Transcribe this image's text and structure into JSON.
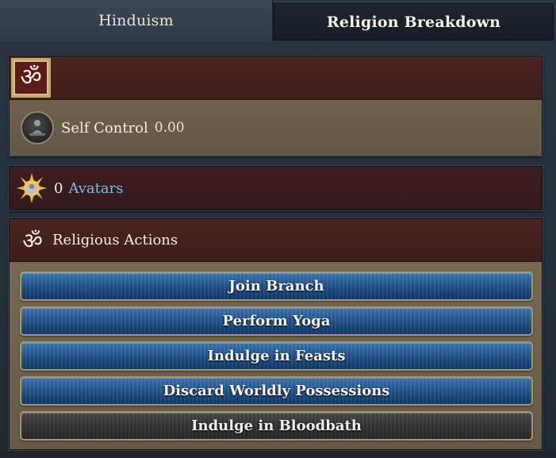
{
  "tabs": {
    "religion_tab": "Hinduism",
    "breakdown_tab": "Religion Breakdown"
  },
  "religion_panel": {
    "icon": "om-icon",
    "stat_icon": "self-control-icon",
    "stat_label": "Self Control",
    "stat_value": "0.00"
  },
  "avatars_panel": {
    "icon": "sun-avatar-icon",
    "count": "0",
    "link_label": "Avatars",
    "link_color": "#7fb8e8"
  },
  "actions_panel": {
    "icon": "om-icon",
    "title": "Religious Actions",
    "buttons": [
      {
        "label": "Join Branch",
        "state": "enabled"
      },
      {
        "label": "Perform Yoga",
        "state": "enabled"
      },
      {
        "label": "Indulge in Feasts",
        "state": "enabled"
      },
      {
        "label": "Discard Worldly Possessions",
        "state": "enabled"
      },
      {
        "label": "Indulge in Bloodbath",
        "state": "disabled"
      }
    ]
  },
  "colors": {
    "button_blue": "#285e98",
    "button_disabled": "#363636",
    "header_maroon": "#4a2421",
    "body_tan": "#6e624d"
  }
}
